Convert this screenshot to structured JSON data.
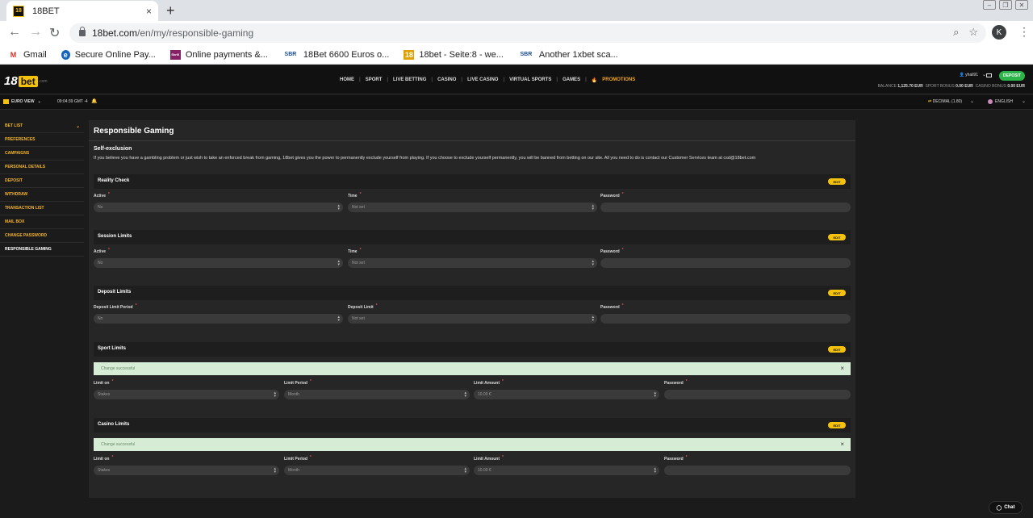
{
  "browser": {
    "tab_title": "18BET",
    "tab_favicon": "18",
    "tab_close": "×",
    "new_tab": "+",
    "url_host": "18bet.com",
    "url_path": "/en/my/responsible-gaming",
    "profile_initial": "K",
    "bookmarks": [
      {
        "icon": "M",
        "icon_color": "#d93025",
        "label": "Gmail"
      },
      {
        "icon": "e",
        "icon_color": "#1565c0",
        "label": "Secure Online Pay..."
      },
      {
        "icon": "Skrill",
        "icon_color": "#862165",
        "label": "Online payments &..."
      },
      {
        "icon": "SBR",
        "icon_color": "#1a4d8f",
        "label": "18Bet 6600 Euros o..."
      },
      {
        "icon": "18",
        "icon_color": "#e0a100",
        "label": "18bet - Seite:8 - we..."
      },
      {
        "icon": "SBR",
        "icon_color": "#1a4d8f",
        "label": "Another 1xbet sca..."
      }
    ]
  },
  "header": {
    "logo_18": "18",
    "logo_bet": "bet",
    "logo_com": ".com",
    "nav": [
      "HOME",
      "SPORT",
      "LIVE BETTING",
      "CASINO",
      "LIVE CASINO",
      "VIRTUAL SPORTS",
      "GAMES"
    ],
    "promotions": "PROMOTIONS",
    "username": "yhali91",
    "deposit": "DEPOSIT",
    "balance_label": "BALANCE",
    "balance": "1,125.70 EUR",
    "sport_bonus_label": "SPORT BONUS",
    "sport_bonus": "0.00 EUR",
    "casino_bonus_label": "CASINO BONUS",
    "casino_bonus": "0.00 EUR"
  },
  "subheader": {
    "euro_view": "EURO VIEW",
    "clock": "09:04:39 GMT -4",
    "odds_format": "DECIMAL (1.80)",
    "language": "ENGLISH"
  },
  "sidebar": {
    "items": [
      {
        "label": "BET LIST",
        "active": false
      },
      {
        "label": "PREFERENCES",
        "active": false
      },
      {
        "label": "CAMPAIGNS",
        "active": false
      },
      {
        "label": "PERSONAL DETAILS",
        "active": false
      },
      {
        "label": "DEPOSIT",
        "active": false
      },
      {
        "label": "WITHDRAW",
        "active": false
      },
      {
        "label": "TRANSACTION LIST",
        "active": false
      },
      {
        "label": "MAIL BOX",
        "active": false
      },
      {
        "label": "CHANGE PASSWORD",
        "active": false
      },
      {
        "label": "RESPONSIBLE GAMING",
        "active": true
      }
    ]
  },
  "main": {
    "title": "Responsible Gaming",
    "self_exclusion_title": "Self-exclusion",
    "self_exclusion_text": "If you believe you have a gambling problem or just wish to take an enforced break from gaming, 18bet gives you the power to permanently exclude yourself from playing. If you choose to exclude yourself permanently, you will be banned from betting on our site. All you need to do is contact our Customer Services team at csd@18bet.com",
    "edit_label": "EDIT",
    "required_mark": "*",
    "reality_check": {
      "title": "Reality Check",
      "active_label": "Active",
      "active_value": "No",
      "time_label": "Time",
      "time_value": "Not set",
      "password_label": "Password"
    },
    "session_limits": {
      "title": "Session Limits",
      "active_label": "Active",
      "active_value": "No",
      "time_label": "Time",
      "time_value": "Not set",
      "password_label": "Password"
    },
    "deposit_limits": {
      "title": "Deposit Limits",
      "period_label": "Deposit Limit Period",
      "period_value": "No",
      "limit_label": "Deposit Limit",
      "limit_value": "Not set",
      "password_label": "Password"
    },
    "sport_limits": {
      "title": "Sport Limits",
      "success": "Change successful",
      "limit_on_label": "Limit on",
      "limit_on_value": "Stakes",
      "period_label": "Limit Period",
      "period_value": "Month",
      "amount_label": "Limit Amount",
      "amount_value": "10.00 €",
      "password_label": "Password"
    },
    "casino_limits": {
      "title": "Casino Limits",
      "success": "Change successful",
      "limit_on_label": "Limit on",
      "limit_on_value": "Stakes",
      "period_label": "Limit Period",
      "period_value": "Month",
      "amount_label": "Limit Amount",
      "amount_value": "10.00 €",
      "password_label": "Password"
    }
  },
  "chat_label": "Chat"
}
